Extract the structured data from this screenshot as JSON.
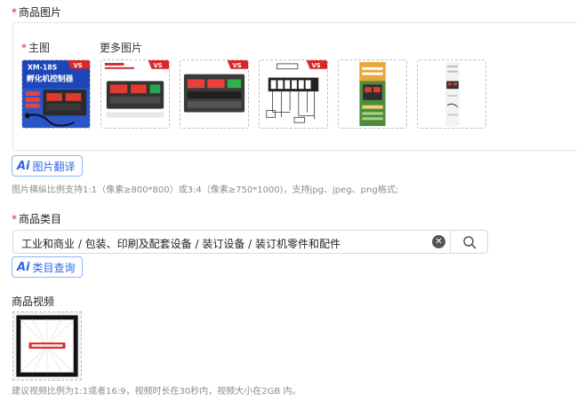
{
  "product_images": {
    "required_mark": "*",
    "title": "商品图片",
    "main_label": "主图",
    "more_label": "更多图片",
    "ai_button_icon": "Ai",
    "ai_button_label": "图片翻译",
    "hint": "图片横纵比例支持1:1（像素≥800*800）或3:4（像素≥750*1000)，支持jpg、jpeg、png格式;",
    "thumbnails": [
      {
        "badge": "VS",
        "line1": "XM-18S",
        "line2": "孵化机控制器"
      },
      {
        "badge": "VS",
        "line1": "",
        "line2": ""
      },
      {
        "badge": "VS",
        "line1": "",
        "line2": ""
      },
      {
        "badge": "VS",
        "line1": "",
        "line2": ""
      },
      {
        "badge": "",
        "line1": "",
        "line2": ""
      },
      {
        "badge": "",
        "line1": "",
        "line2": ""
      }
    ]
  },
  "category": {
    "required_mark": "*",
    "title": "商品类目",
    "value": "工业和商业 / 包装、印刷及配套设备 / 装订设备 / 装订机零件和配件",
    "ai_button_icon": "Ai",
    "ai_button_label": "类目查询"
  },
  "video": {
    "title": "商品视频",
    "hint": "建议视频比例为1:1或者16:9，视频时长在30秒内，视频大小在2GB 内。"
  },
  "colors": {
    "accent": "#2f66e8",
    "required": "#e02020",
    "hint": "#8c8c8c"
  }
}
